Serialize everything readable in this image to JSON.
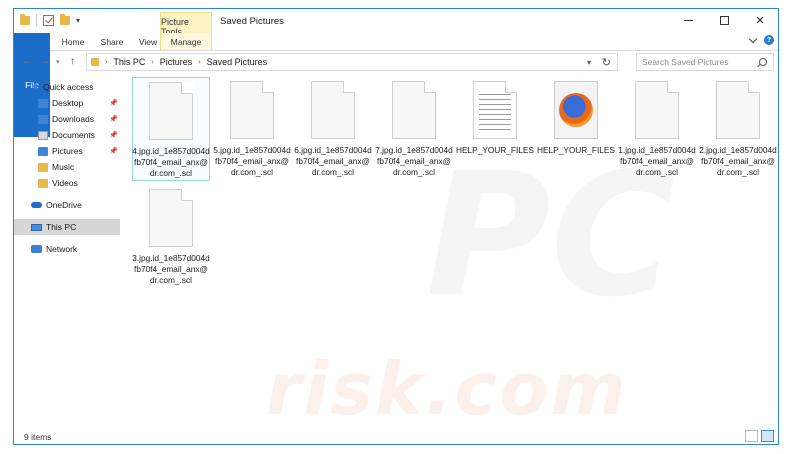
{
  "window": {
    "title": "Saved Pictures",
    "context_tab": "Picture Tools"
  },
  "ribbon": {
    "tabs": [
      "File",
      "Home",
      "Share",
      "View",
      "Manage"
    ]
  },
  "address": {
    "crumbs": [
      "This PC",
      "Pictures",
      "Saved Pictures"
    ]
  },
  "search": {
    "placeholder": "Search Saved Pictures"
  },
  "nav": {
    "quick_access": "Quick access",
    "items": [
      "Desktop",
      "Downloads",
      "Documents",
      "Pictures",
      "Music",
      "Videos"
    ],
    "onedrive": "OneDrive",
    "this_pc": "This PC",
    "network": "Network"
  },
  "files": [
    {
      "name": "4.jpg.id_1e857d004dfb70f4_email_anx@dr.com_.scl",
      "icon": "blank-document-icon"
    },
    {
      "name": "5.jpg.id_1e857d004dfb70f4_email_anx@dr.com_.scl",
      "icon": "blank-document-icon"
    },
    {
      "name": "6.jpg.id_1e857d004dfb70f4_email_anx@dr.com_.scl",
      "icon": "blank-document-icon"
    },
    {
      "name": "7.jpg.id_1e857d004dfb70f4_email_anx@dr.com_.scl",
      "icon": "blank-document-icon"
    },
    {
      "name": "HELP_YOUR_FILES",
      "icon": "text-document-icon"
    },
    {
      "name": "HELP_YOUR_FILES",
      "icon": "firefox-html-icon"
    },
    {
      "name": "1.jpg.id_1e857d004dfb70f4_email_anx@dr.com_.scl",
      "icon": "blank-document-icon"
    },
    {
      "name": "2.jpg.id_1e857d004dfb70f4_email_anx@dr.com_.scl",
      "icon": "blank-document-icon"
    },
    {
      "name": "3.jpg.id_1e857d004dfb70f4_email_anx@dr.com_.scl",
      "icon": "blank-document-icon"
    }
  ],
  "status": {
    "count": "9 items"
  },
  "watermark": {
    "text": "risk.com",
    "pc": "PC"
  }
}
